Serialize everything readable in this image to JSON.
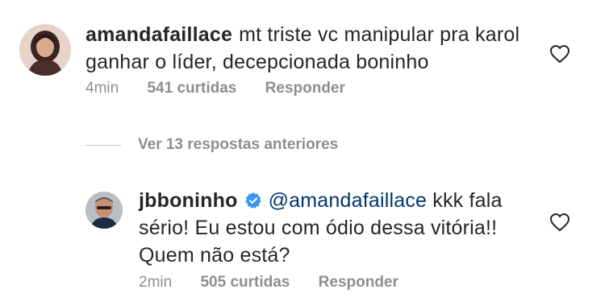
{
  "comment": {
    "username": "amandafaillace",
    "text": "mt triste vc manipular pra karol ganhar o líder, decepcionada boninho",
    "time": "4min",
    "likes": "541 curtidas",
    "reply_label": "Responder"
  },
  "view_replies": {
    "label": "Ver 13 respostas anteriores"
  },
  "reply": {
    "username": "jbboninho",
    "verified_icon": "verified-badge-icon",
    "mention": "@amandafaillace",
    "text": " kkk fala sério! Eu estou com ódio dessa vitória!! Quem não está?",
    "time": "2min",
    "likes": "505 curtidas",
    "reply_label": "Responder"
  },
  "icons": {
    "like": "heart-outline-icon",
    "verified_color": "#3897f0"
  }
}
